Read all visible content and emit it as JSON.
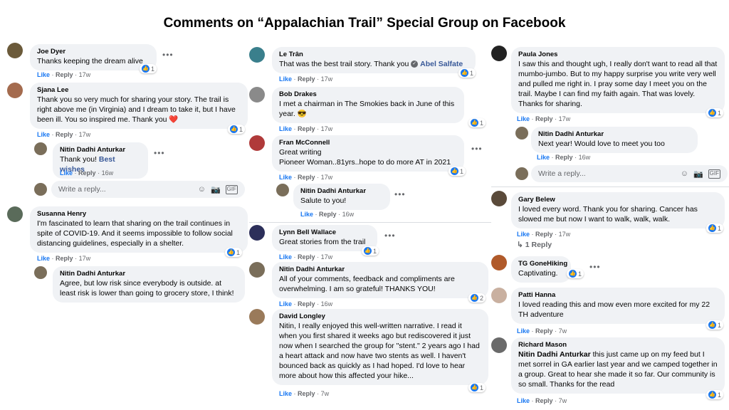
{
  "title": "Comments on “Appalachian Trail” Special Group on Facebook",
  "labels": {
    "like": "Like",
    "reply": "Reply",
    "sep": "·",
    "write_placeholder": "Write a reply...",
    "view_reply": "1 Reply"
  },
  "col1": {
    "joe": {
      "name": "Joe Dyer",
      "text": "Thanks keeping the dream alive",
      "time": "17w",
      "count": "1"
    },
    "sjana": {
      "name": "Sjana Lee",
      "text": "Thank you so very much for sharing your story. The trail is right above me (in Virginia) and I dream to take it, but I have been ill. You so inspired me. Thank you ❤️",
      "time": "17w",
      "count": "1"
    },
    "nitin1": {
      "name": "Nitin Dadhi Anturkar",
      "text_pre": "Thank you! ",
      "text_mention": "Best wishes",
      "time": "16w"
    },
    "susanna": {
      "name": "Susanna Henry",
      "text": "I'm fascinated to learn that sharing on the trail continues in spite of COVID-19. And it seems impossible to follow social distancing guidelines, especially in a shelter.",
      "time": "17w",
      "count": "1"
    },
    "nitin2": {
      "name": "Nitin Dadhi Anturkar",
      "text": "Agree, but low risk since everybody is outside. at least risk is lower than going to grocery store, I think!"
    }
  },
  "col2": {
    "le": {
      "name": "Le Trân",
      "text": "That was the best trail story. Thank you ",
      "mention": "Abel Salfate",
      "time": "17w",
      "count": "1"
    },
    "bob": {
      "name": "Bob Drakes",
      "text": "I met a chairman in The Smokies back in June of this year. 😎",
      "time": "17w",
      "count": "1"
    },
    "fran": {
      "name": "Fran McConnell",
      "text": "Great writing\nPioneer Woman..81yrs..hope to do more AT in 2021",
      "time": "17w",
      "count": "1"
    },
    "nitin3": {
      "name": "Nitin Dadhi Anturkar",
      "text": "Salute to you!",
      "time": "16w"
    },
    "lynn": {
      "name": "Lynn Bell Wallace",
      "text": "Great stories from the trail",
      "time": "17w",
      "count": "1"
    },
    "nitin4": {
      "name": "Nitin Dadhi Anturkar",
      "text": "All of your comments, feedback and compliments are overwhelming. I am so grateful! THANKS YOU!",
      "time": "16w",
      "count": "2"
    },
    "david": {
      "name": "David Longley",
      "text": "Nitin, I really enjoyed this well-written narrative. I read it when you first shared it weeks ago but rediscovered it just now when I searched the group for \"stent.\" 2 years ago I had a heart attack and now have two stents as well. I haven't bounced back as quickly as I had hoped. I'd love to hear more about how this affected your hike...",
      "time": "7w",
      "count": "1"
    }
  },
  "col3": {
    "paula": {
      "name": "Paula Jones",
      "text": "I saw this and thought ugh, I really don't want to read all that mumbo-jumbo. But to my happy surprise you write very well and pulled me right in. I pray some day I meet you on the trail. Maybe I can find my faith again. That was lovely. Thanks for sharing.",
      "time": "17w",
      "count": "1"
    },
    "nitin5": {
      "name": "Nitin Dadhi Anturkar",
      "text": "Next year! Would love to meet you too",
      "time": "16w"
    },
    "gary": {
      "name": "Gary Belew",
      "text": "I loved every word. Thank you for sharing. Cancer has slowed me but now I want to walk, walk, walk.",
      "time": "17w",
      "count": "1"
    },
    "tg": {
      "name": "TG GoneHiking",
      "text": "Captivating.",
      "count": "1"
    },
    "patti": {
      "name": "Patti Hanna",
      "text": "I loved reading this and mow even more excited for my 22 TH adventure",
      "time": "7w",
      "count": "1"
    },
    "richard": {
      "name": "Richard Mason",
      "mention": "Nitin Dadhi Anturkar",
      "text": " this just came up on my feed but I met sorrel in GA earlier last year and we camped together in a group. Great to hear she made it so far. Our community is so small. Thanks for the read",
      "time": "7w",
      "count": "1"
    }
  },
  "colors": {
    "accent": "#1877f2",
    "bubble": "#f0f2f5",
    "meta": "#65676b",
    "mention": "#385898"
  }
}
